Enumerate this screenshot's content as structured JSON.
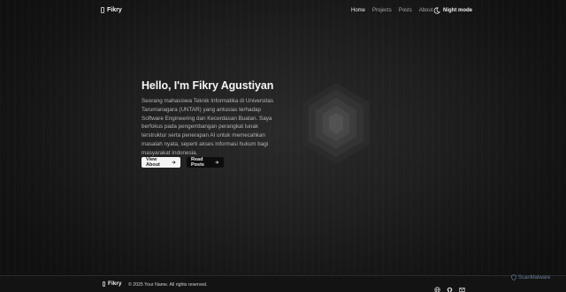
{
  "header": {
    "brand": "Fikry",
    "nav": [
      {
        "label": "Home",
        "active": true
      },
      {
        "label": "Projects",
        "active": false
      },
      {
        "label": "Posts",
        "active": false
      },
      {
        "label": "About",
        "active": false
      }
    ],
    "night_mode_label": "Night mode",
    "night_mode_icon": "moon-icon"
  },
  "hero": {
    "title": "Hello, I'm Fikry Agustiyan",
    "description": "Seorang mahasiswa Teknik Informatika di Universitas Tarumanagara (UNTAR) yang antusias terhadap Software Engineering dan Kecerdasan Buatan. Saya berfokus pada pengembangan perangkat lunak terstruktur serta penerapan AI untuk memecahkan masalah nyata, seperti akses informasi hukum bagi masyarakat Indonesia.",
    "primary_button": "View About",
    "secondary_button": "Read Posts",
    "button_icon": "arrow-right-icon",
    "art_icon": "hexagon-layers-art"
  },
  "footer": {
    "brand": "Fikry",
    "copyright": "© 2025 Your Name. All rights reserved.",
    "social_icons": [
      "globe-icon",
      "github-icon",
      "mail-icon"
    ]
  },
  "watermark": "ScanMalware",
  "colors": {
    "background": "#151515",
    "primary_button_bg": "#f4f4f4",
    "secondary_button_bg": "#0d0d0d"
  }
}
